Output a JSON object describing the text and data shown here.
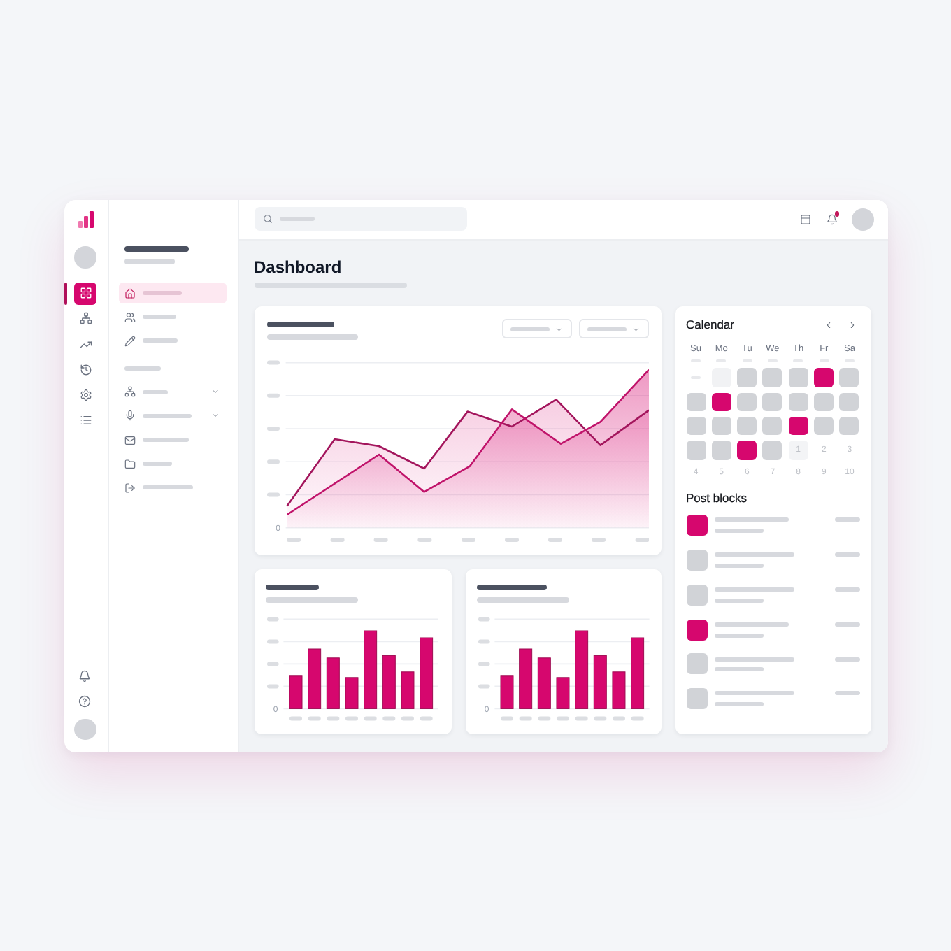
{
  "rail": {
    "items": [
      {
        "selected": true
      },
      {
        "selected": false
      },
      {
        "selected": false
      },
      {
        "selected": false
      },
      {
        "selected": false
      },
      {
        "selected": false
      }
    ]
  },
  "nav": {
    "items": [
      {
        "selected": true
      },
      {
        "selected": false
      },
      {
        "selected": false
      }
    ],
    "section_items": [
      {
        "selected": false,
        "expanded": false
      },
      {
        "selected": false,
        "expanded": false
      },
      {
        "selected": false
      },
      {
        "selected": false
      },
      {
        "selected": false
      }
    ]
  },
  "top_bar": {
    "notifications_unread": true
  },
  "page": {
    "title": "Dashboard"
  },
  "line_card": {
    "filters": [
      {
        "expanded": false
      },
      {
        "expanded": false
      }
    ],
    "y_axis_label": "0"
  },
  "bar_cards": [
    {
      "y_axis_label": "0"
    },
    {
      "y_axis_label": "0"
    }
  ],
  "calendar": {
    "title": "Calendar",
    "weekdays": [
      "Su",
      "Mo",
      "Tu",
      "We",
      "Th",
      "Fr",
      "Sa"
    ],
    "weeks": [
      [
        {
          "kind": "placeholder"
        },
        {
          "kind": "placeholder"
        },
        {
          "kind": "placeholder"
        },
        {
          "kind": "placeholder"
        },
        {
          "kind": "placeholder"
        },
        {
          "kind": "placeholder"
        },
        {
          "kind": "placeholder"
        }
      ],
      [
        {
          "kind": "placeholder"
        },
        {
          "kind": "block",
          "color": "#f1f2f4"
        },
        {
          "kind": "block",
          "color": "#d1d3d7"
        },
        {
          "kind": "block",
          "color": "#d1d3d7"
        },
        {
          "kind": "block",
          "color": "#d1d3d7"
        },
        {
          "kind": "block",
          "color": "#d6076e"
        },
        {
          "kind": "block",
          "color": "#d1d3d7"
        }
      ],
      [
        {
          "kind": "block",
          "color": "#d1d3d7"
        },
        {
          "kind": "block",
          "color": "#d6076e"
        },
        {
          "kind": "block",
          "color": "#d1d3d7"
        },
        {
          "kind": "block",
          "color": "#d1d3d7"
        },
        {
          "kind": "block",
          "color": "#d1d3d7"
        },
        {
          "kind": "block",
          "color": "#d1d3d7"
        },
        {
          "kind": "block",
          "color": "#d1d3d7"
        }
      ],
      [
        {
          "kind": "block",
          "color": "#d1d3d7"
        },
        {
          "kind": "block",
          "color": "#d1d3d7"
        },
        {
          "kind": "block",
          "color": "#d1d3d7"
        },
        {
          "kind": "block",
          "color": "#d1d3d7"
        },
        {
          "kind": "block",
          "color": "#d6076e"
        },
        {
          "kind": "block",
          "color": "#d1d3d7"
        },
        {
          "kind": "block",
          "color": "#d1d3d7"
        }
      ],
      [
        {
          "kind": "block",
          "color": "#d1d3d7"
        },
        {
          "kind": "block",
          "color": "#d1d3d7"
        },
        {
          "kind": "block",
          "color": "#d6076e"
        },
        {
          "kind": "block",
          "color": "#d1d3d7"
        },
        {
          "kind": "date",
          "label": "1",
          "shaded": true
        },
        {
          "kind": "date",
          "label": "2",
          "shaded": false
        },
        {
          "kind": "date",
          "label": "3",
          "shaded": false
        }
      ],
      [
        {
          "kind": "date",
          "label": "4",
          "shaded": false
        },
        {
          "kind": "date",
          "label": "5",
          "shaded": false
        },
        {
          "kind": "date",
          "label": "6",
          "shaded": false
        },
        {
          "kind": "date",
          "label": "7",
          "shaded": false
        },
        {
          "kind": "date",
          "label": "8",
          "shaded": false
        },
        {
          "kind": "date",
          "label": "9",
          "shaded": false
        },
        {
          "kind": "date",
          "label": "10",
          "shaded": false
        }
      ]
    ]
  },
  "post_blocks": {
    "title": "Post blocks",
    "items": [
      {
        "color": "#d6076e"
      },
      {
        "color": "#d1d3d7"
      },
      {
        "color": "#d1d3d7"
      },
      {
        "color": "#d6076e"
      },
      {
        "color": "#d1d3d7"
      },
      {
        "color": "#d1d3d7"
      }
    ]
  }
}
